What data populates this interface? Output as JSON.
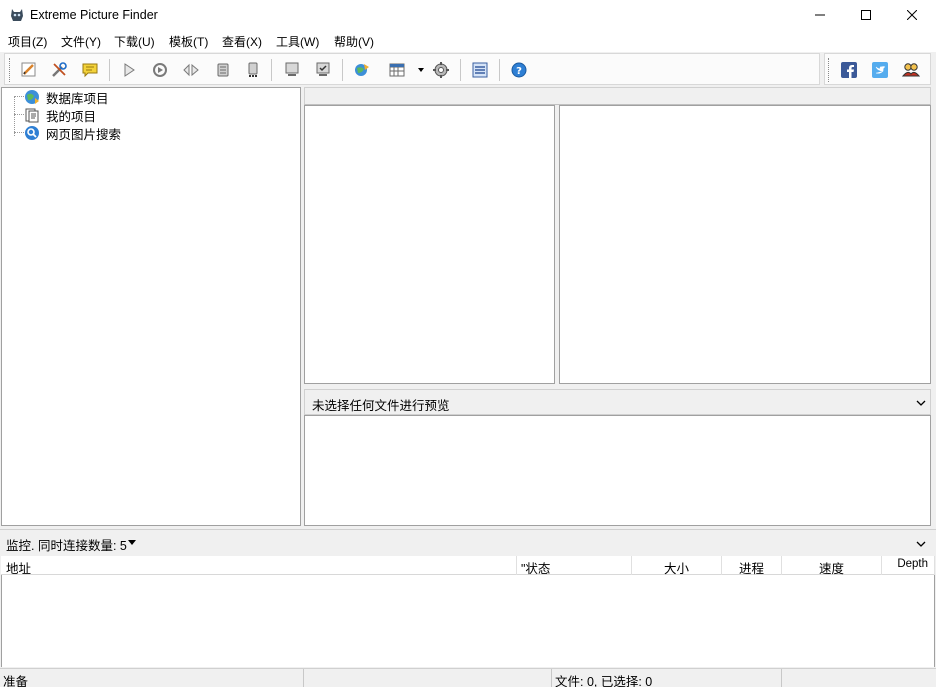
{
  "window": {
    "title": "Extreme Picture Finder"
  },
  "menu": [
    "项目(Z)",
    "文件(Y)",
    "下载(U)",
    "模板(T)",
    "查看(X)",
    "工具(W)",
    "帮助(V)"
  ],
  "toolbar": {
    "icons": [
      "new-project-icon",
      "edit-project-icon",
      "comment-icon",
      "start-icon",
      "refresh-icon",
      "play-pause-icon",
      "stop-icon",
      "stop-all-icon",
      "monitor-icon",
      "monitor-check-icon",
      "web-explore-icon",
      "grid-view-icon",
      "settings-icon",
      "thumbnails-icon",
      "help-icon"
    ],
    "social": [
      "facebook-icon",
      "twitter-icon",
      "community-icon"
    ]
  },
  "tree": {
    "items": [
      {
        "label": "数据库项目",
        "icon": "database-globe-icon"
      },
      {
        "label": "我的项目",
        "icon": "my-projects-icon"
      },
      {
        "label": "网页图片搜索",
        "icon": "web-search-icon"
      }
    ]
  },
  "preview": {
    "label": "未选择任何文件进行预览"
  },
  "monitor": {
    "label": "监控. 同时连接数量: 5"
  },
  "list": {
    "columns": [
      "地址",
      "\"状态",
      "大小",
      "进程",
      "速度",
      "Depth"
    ]
  },
  "status": {
    "ready": "准备",
    "files": "文件: 0, 已选择: 0"
  },
  "colors": {
    "accent": "#1e6cc8",
    "panel_border": "#a0a0a0",
    "chrome": "#f0f0f0"
  }
}
